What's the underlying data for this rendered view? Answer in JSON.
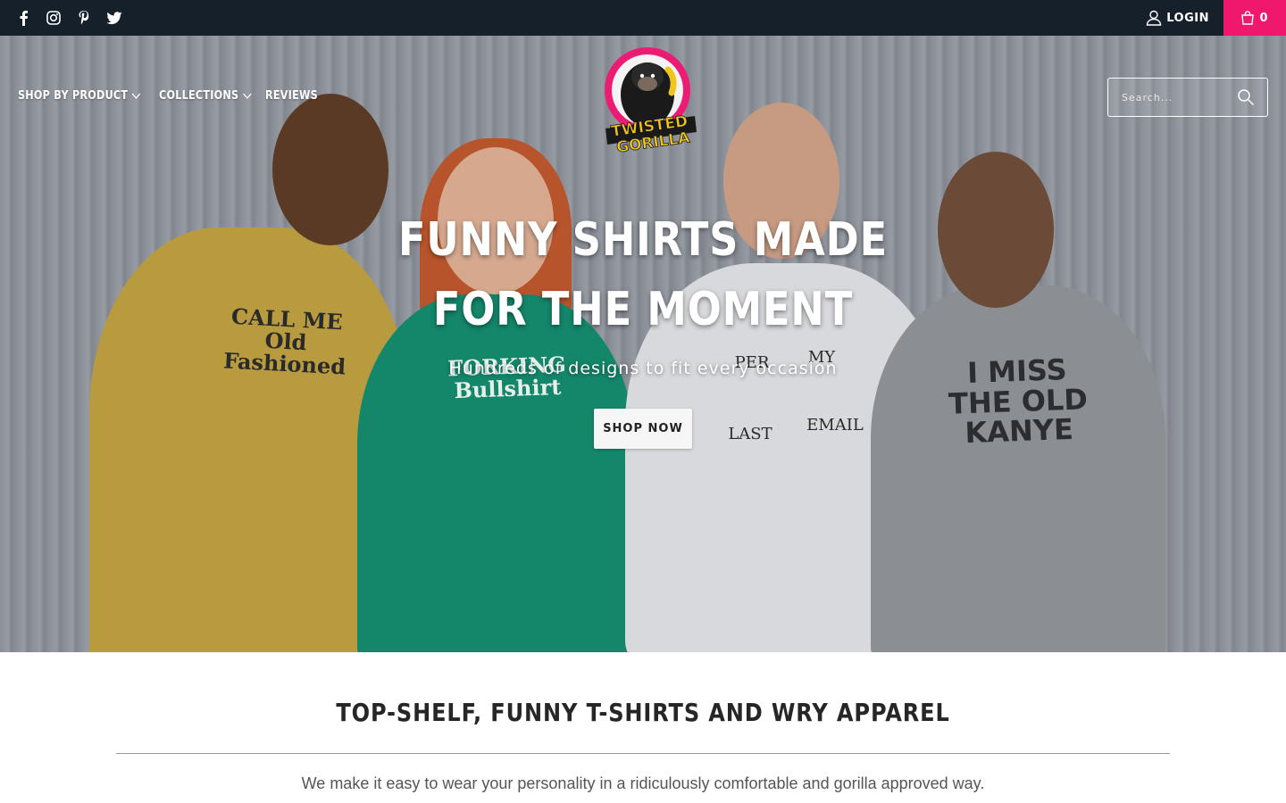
{
  "topbar": {
    "social": [
      {
        "icon": "facebook-icon"
      },
      {
        "icon": "instagram-icon"
      },
      {
        "icon": "pinterest-icon"
      },
      {
        "icon": "twitter-icon"
      }
    ],
    "login_label": "Login",
    "cart_count": "0",
    "cart_color": "#f0186c",
    "bar_color": "#15202b"
  },
  "nav": {
    "items": [
      {
        "label": "Shop By Product",
        "has_dropdown": true
      },
      {
        "label": "Collections",
        "has_dropdown": true
      },
      {
        "label": "Reviews",
        "has_dropdown": false
      }
    ]
  },
  "logo": {
    "line1": "TWISTED",
    "line2": "GORILLA"
  },
  "search": {
    "placeholder": "Search..."
  },
  "hero": {
    "title": "FUNNY SHIRTS MADE FOR THE MOMENT",
    "subtitle": "Hundreds of designs to fit every occasion",
    "button_label": "SHOP NOW",
    "shirts": {
      "shirt1": "CALL ME Old Fashioned",
      "shirt2": "FORKING Bullshirt",
      "shirt3a": "PER",
      "shirt3b": "MY",
      "shirt3c": "LAST",
      "shirt3d": "EMAIL",
      "shirt4": "I MISS THE OLD KANYE"
    }
  },
  "intro": {
    "title": "TOP-SHELF, FUNNY T-SHIRTS AND WRY APPAREL",
    "text": "We make it easy to wear your personality in a ridiculously comfortable and gorilla approved way."
  }
}
